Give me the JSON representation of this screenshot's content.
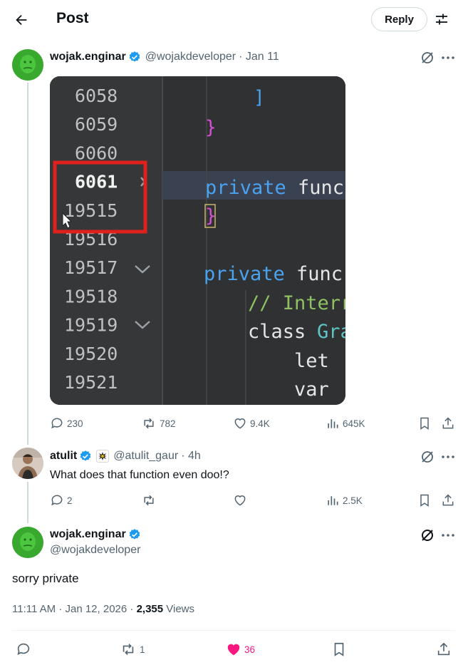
{
  "header": {
    "title": "Post",
    "reply_button": "Reply"
  },
  "main_post": {
    "name": "wojak.enginar",
    "handle": "@wojakdeveloper",
    "date": "· Jan 11",
    "code_lines": [
      {
        "num": "6058",
        "highlight": false
      },
      {
        "num": "6059",
        "highlight": false
      },
      {
        "num": "6060",
        "highlight": false
      },
      {
        "num": "6061",
        "highlight": true
      },
      {
        "num": "19515",
        "highlight": false
      },
      {
        "num": "19516",
        "highlight": false
      },
      {
        "num": "19517",
        "highlight": false
      },
      {
        "num": "19518",
        "highlight": false
      },
      {
        "num": "19519",
        "highlight": false
      },
      {
        "num": "19520",
        "highlight": false
      },
      {
        "num": "19521",
        "highlight": false
      }
    ],
    "code": {
      "bracket": "]",
      "brace1": "}",
      "kw1": "private",
      "fn1": "func",
      "brace2": "}",
      "kw2": "private",
      "fn2": "func",
      "comment": "// Interr",
      "class_kw": "class",
      "class_name": "Gra",
      "let": "let",
      "var": "var"
    },
    "stats": {
      "replies": "230",
      "reposts": "782",
      "likes": "9.4K",
      "views": "645K"
    }
  },
  "reply": {
    "name": "atulit",
    "handle": "@atulit_gaur",
    "time": "· 4h",
    "text": "What does that function even doo!?",
    "stats": {
      "replies": "2",
      "reposts": "",
      "likes": "",
      "views": "2.5K"
    }
  },
  "focused_post": {
    "name": "wojak.enginar",
    "handle": "@wojakdeveloper",
    "text": "sorry private",
    "timestamp": "11:11 AM · Jan 12, 2026 · ",
    "views_count": "2,355",
    "views_label": " Views",
    "stats": {
      "reposts": "1",
      "likes": "36"
    }
  },
  "colors": {
    "verified": "#1d9bf0",
    "like": "#f91880",
    "secondary": "#536471",
    "code_bg": "#2f3132",
    "highlight_box": "#e0201c"
  }
}
